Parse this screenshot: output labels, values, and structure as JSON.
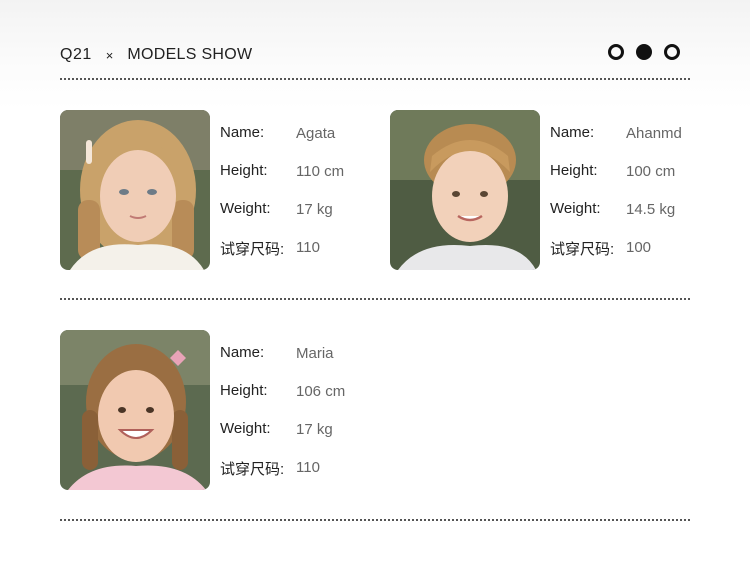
{
  "header": {
    "code": "Q21",
    "separator": "×",
    "title": "MODELS SHOW"
  },
  "pager": {
    "count": 3,
    "active_index": 1
  },
  "labels": {
    "name": "Name:",
    "height": "Height:",
    "weight": "Weight:",
    "size": "试穿尺码:"
  },
  "models": [
    {
      "name": "Agata",
      "height": "110 cm",
      "weight": "17 kg",
      "size": "110",
      "photo": "girl-blonde-hair-clip-white-top"
    },
    {
      "name": "Ahanmd",
      "height": "100 cm",
      "weight": "14.5 kg",
      "size": "100",
      "photo": "boy-blond-white-top"
    },
    {
      "name": "Maria",
      "height": "106 cm",
      "weight": "17 kg",
      "size": "110",
      "photo": "girl-smiling-pink-top"
    }
  ]
}
